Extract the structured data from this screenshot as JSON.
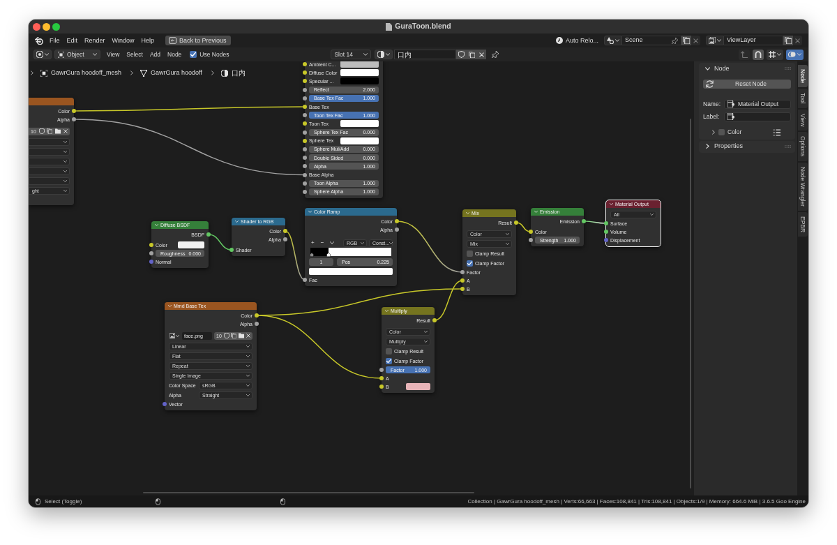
{
  "window": {
    "title": "GuraToon.blend"
  },
  "top_bar": {
    "menus": [
      "File",
      "Edit",
      "Render",
      "Window",
      "Help"
    ],
    "back_button": "Back to Previous",
    "auto_reload": "Auto Relo...",
    "scene": "Scene",
    "view_layer": "ViewLayer"
  },
  "editor_header": {
    "mode": "Object",
    "menus": [
      "View",
      "Select",
      "Add",
      "Node"
    ],
    "use_nodes": {
      "label": "Use Nodes",
      "checked": true
    },
    "slot": "Slot 14",
    "material": "口内",
    "parent_up": {
      "disabled": true
    },
    "snap": {
      "on": true
    },
    "overlays": {
      "on": true
    }
  },
  "breadcrumb": [
    {
      "kind": "object",
      "label": "GawrGura hoodoff_mesh"
    },
    {
      "kind": "mesh",
      "label": "GawrGura hoodoff"
    },
    {
      "kind": "material",
      "label": "口内"
    }
  ],
  "nodes": [
    {
      "color": "#9a5520",
      "selected": false,
      "rows": [
        {
          "kind": "output",
          "label": "Color",
          "socket": {
            "color": "#c7c729"
          }
        },
        {
          "kind": "output",
          "label": "Alpha",
          "socket": {
            "color": "#a1a1a1"
          }
        },
        {
          "kind": "image",
          "users": "10"
        },
        {
          "kind": "dropdown"
        },
        {
          "kind": "dropdown"
        },
        {
          "kind": "dropdown"
        },
        {
          "kind": "dropdown"
        },
        {
          "kind": "dropdown"
        },
        {
          "kind": "dropdown",
          "value": "ght"
        }
      ]
    },
    {
      "selected": false,
      "rows": [
        {
          "kind": "swatch",
          "label": "Ambient C...",
          "socket": {
            "color": "#c7c729"
          },
          "color": "#bdbdbd"
        },
        {
          "kind": "swatch",
          "label": "Diffuse Color",
          "socket": {
            "color": "#c7c729"
          },
          "color": "#ffffff"
        },
        {
          "kind": "swatch",
          "label": "Specular ...",
          "socket": {
            "color": "#c7c729"
          },
          "color": "#000000"
        },
        {
          "kind": "number",
          "label": "Reflect",
          "value": "2.000",
          "socket": {
            "color": "#a1a1a1"
          }
        },
        {
          "kind": "slider",
          "label": "Base Tex Fac",
          "value": "1.000",
          "level": 1,
          "socket": {
            "color": "#a1a1a1"
          }
        },
        {
          "kind": "input",
          "label": "Base Tex",
          "socket": {
            "color": "#c7c729"
          }
        },
        {
          "kind": "slider",
          "label": "Toon Tex Fac",
          "value": "1.000",
          "level": 1,
          "socket": {
            "color": "#a1a1a1"
          }
        },
        {
          "kind": "swatch",
          "label": "Toon Tex",
          "socket": {
            "color": "#c7c729"
          },
          "color": "#ffffff"
        },
        {
          "kind": "number",
          "label": "Sphere Tex Fac",
          "value": "0.000",
          "socket": {
            "color": "#a1a1a1"
          }
        },
        {
          "kind": "swatch",
          "label": "Sphere Tex",
          "socket": {
            "color": "#c7c729"
          },
          "color": "#ffffff"
        },
        {
          "kind": "number",
          "label": "Sphere Mul/Add",
          "value": "0.000",
          "socket": {
            "color": "#a1a1a1"
          }
        },
        {
          "kind": "number",
          "label": "Double Sided",
          "value": "0.000",
          "socket": {
            "color": "#a1a1a1"
          }
        },
        {
          "kind": "number",
          "label": "Alpha",
          "value": "1.000",
          "socket": {
            "color": "#a1a1a1"
          }
        },
        {
          "kind": "input",
          "label": "Base Alpha",
          "socket": {
            "color": "#a1a1a1"
          }
        },
        {
          "kind": "number",
          "label": "Toon Alpha",
          "value": "1.000",
          "socket": {
            "color": "#a1a1a1"
          }
        },
        {
          "kind": "number",
          "label": "Sphere Alpha",
          "value": "1.000",
          "socket": {
            "color": "#a1a1a1"
          }
        }
      ]
    },
    {
      "title": "Diffuse BSDF",
      "color": "#35803a",
      "selected": false,
      "rows": [
        {
          "kind": "output",
          "label": "BSDF",
          "socket": {
            "color": "#63c763"
          }
        },
        {
          "kind": "swatch",
          "label": "Color",
          "socket": {
            "color": "#c7c729"
          },
          "color": "#f2f2f2"
        },
        {
          "kind": "number",
          "label": "Roughness",
          "value": "0.000",
          "socket": {
            "color": "#a1a1a1"
          }
        },
        {
          "kind": "input",
          "label": "Normal",
          "socket": {
            "color": "#6363c7"
          }
        }
      ]
    },
    {
      "title": "Shader to RGB",
      "color": "#2b6a8e",
      "selected": false,
      "rows": [
        {
          "kind": "output",
          "label": "Color",
          "socket": {
            "color": "#c7c729"
          }
        },
        {
          "kind": "output",
          "label": "Alpha",
          "socket": {
            "color": "#a1a1a1"
          }
        },
        {
          "kind": "input",
          "label": "Shader",
          "socket": {
            "color": "#63c763"
          }
        }
      ]
    },
    {
      "title": "Color Ramp",
      "color": "#2b6a8e",
      "selected": false,
      "rows": [
        {
          "kind": "output",
          "label": "Color",
          "socket": {
            "color": "#c7c729"
          }
        },
        {
          "kind": "output",
          "label": "Alpha",
          "socket": {
            "color": "#a1a1a1"
          }
        },
        {
          "kind": "ramp_controls",
          "add": "+",
          "remove": "−",
          "color_mode": "RGB",
          "interpolation": "Const..."
        },
        {
          "kind": "ramp",
          "level": 0.225
        },
        {
          "kind": "ramp_stop",
          "index": "1",
          "label": "Pos",
          "value": "0.225"
        },
        {
          "kind": "ramp_color",
          "color": "#ffffff"
        },
        {
          "kind": "input",
          "label": "Fac",
          "socket": {
            "color": "#a1a1a1"
          }
        }
      ]
    },
    {
      "title": "Mix",
      "color": "#75741f",
      "selected": false,
      "rows": [
        {
          "kind": "output",
          "label": "Result",
          "socket": {
            "color": "#c7c729"
          }
        },
        {
          "kind": "dropdown",
          "value": "Color"
        },
        {
          "kind": "dropdown",
          "value": "Mix"
        },
        {
          "kind": "checkbox",
          "label": "Clamp Result",
          "checked": false
        },
        {
          "kind": "checkbox",
          "label": "Clamp Factor",
          "checked": true
        },
        {
          "kind": "input",
          "label": "Factor",
          "socket": {
            "color": "#a1a1a1"
          }
        },
        {
          "kind": "input",
          "label": "A",
          "socket": {
            "color": "#c7c729"
          }
        },
        {
          "kind": "input",
          "label": "B",
          "socket": {
            "color": "#c7c729"
          }
        }
      ]
    },
    {
      "title": "Emission",
      "color": "#35803a",
      "selected": false,
      "rows": [
        {
          "kind": "output",
          "label": "Emission",
          "socket": {
            "color": "#63c763"
          }
        },
        {
          "kind": "input",
          "label": "Color",
          "socket": {
            "color": "#c7c729"
          }
        },
        {
          "kind": "number",
          "label": "Strength",
          "value": "1.000",
          "socket": {
            "color": "#a1a1a1"
          }
        }
      ]
    },
    {
      "title": "Material Output",
      "color": "#6a2130",
      "selected": true,
      "rows": [
        {
          "kind": "dropdown",
          "value": "All"
        },
        {
          "kind": "input",
          "label": "Surface",
          "socket": {
            "color": "#63c763"
          }
        },
        {
          "kind": "input",
          "label": "Volume",
          "socket": {
            "color": "#63c763"
          }
        },
        {
          "kind": "input",
          "label": "Displacement",
          "socket": {
            "color": "#6363c7"
          }
        }
      ]
    },
    {
      "title": "Mmd Base Tex",
      "color": "#9a5520",
      "selected": false,
      "rows": [
        {
          "kind": "output",
          "label": "Color",
          "socket": {
            "color": "#c7c729"
          }
        },
        {
          "kind": "output",
          "label": "Alpha",
          "socket": {
            "color": "#a1a1a1"
          }
        },
        {
          "kind": "image",
          "file": "face.png",
          "users": "10"
        },
        {
          "kind": "dropdown",
          "value": "Linear"
        },
        {
          "kind": "dropdown",
          "value": "Flat"
        },
        {
          "kind": "dropdown",
          "value": "Repeat"
        },
        {
          "kind": "dropdown",
          "value": "Single Image"
        },
        {
          "kind": "dropdown",
          "label": "Color Space",
          "value": "sRGB"
        },
        {
          "kind": "dropdown",
          "label": "Alpha",
          "value": "Straight"
        },
        {
          "kind": "input",
          "label": "Vector",
          "socket": {
            "color": "#6363c7"
          }
        }
      ]
    },
    {
      "title": "Multiply",
      "color": "#75741f",
      "selected": false,
      "rows": [
        {
          "kind": "output",
          "label": "Result",
          "socket": {
            "color": "#c7c729"
          }
        },
        {
          "kind": "dropdown",
          "value": "Color"
        },
        {
          "kind": "dropdown",
          "value": "Multiply"
        },
        {
          "kind": "checkbox",
          "label": "Clamp Result",
          "checked": false
        },
        {
          "kind": "checkbox",
          "label": "Clamp Factor",
          "checked": true
        },
        {
          "kind": "slider",
          "label": "Factor",
          "value": "1.000",
          "level": 1,
          "socket": {
            "color": "#a1a1a1"
          }
        },
        {
          "kind": "input",
          "label": "A",
          "socket": {
            "color": "#c7c729"
          }
        },
        {
          "kind": "swatch",
          "label": "B",
          "socket": {
            "color": "#c7c729"
          },
          "color": "#e8b4b8"
        }
      ]
    }
  ],
  "sidebar": {
    "node_panel": {
      "title": "Node",
      "expanded": true,
      "reset_button": "Reset Node",
      "fields": [
        {
          "label": "Name:",
          "value": "Material Output"
        },
        {
          "label": "Label:"
        }
      ],
      "color_subpanel": {
        "label": "Color",
        "expanded": false,
        "custom_color": false
      }
    },
    "properties_panel": {
      "title": "Properties",
      "expanded": false
    }
  },
  "sidebar_tabs": [
    {
      "label": "Node",
      "selected": true
    },
    {
      "label": "Tool",
      "selected": false
    },
    {
      "label": "View",
      "selected": false
    },
    {
      "label": "Options",
      "selected": false
    },
    {
      "label": "Node Wrangler",
      "selected": false
    },
    {
      "label": "EPBR",
      "selected": false
    }
  ],
  "status_bar": {
    "hint": "Select (Toggle)",
    "info": "Collection | GawrGura hoodoff_mesh | Verts:66,663 | Faces:108,841 | Tris:108,841 | Objects:1/9 | Memory: 664.6 MiB | 3.6.5 Goo Engine"
  }
}
